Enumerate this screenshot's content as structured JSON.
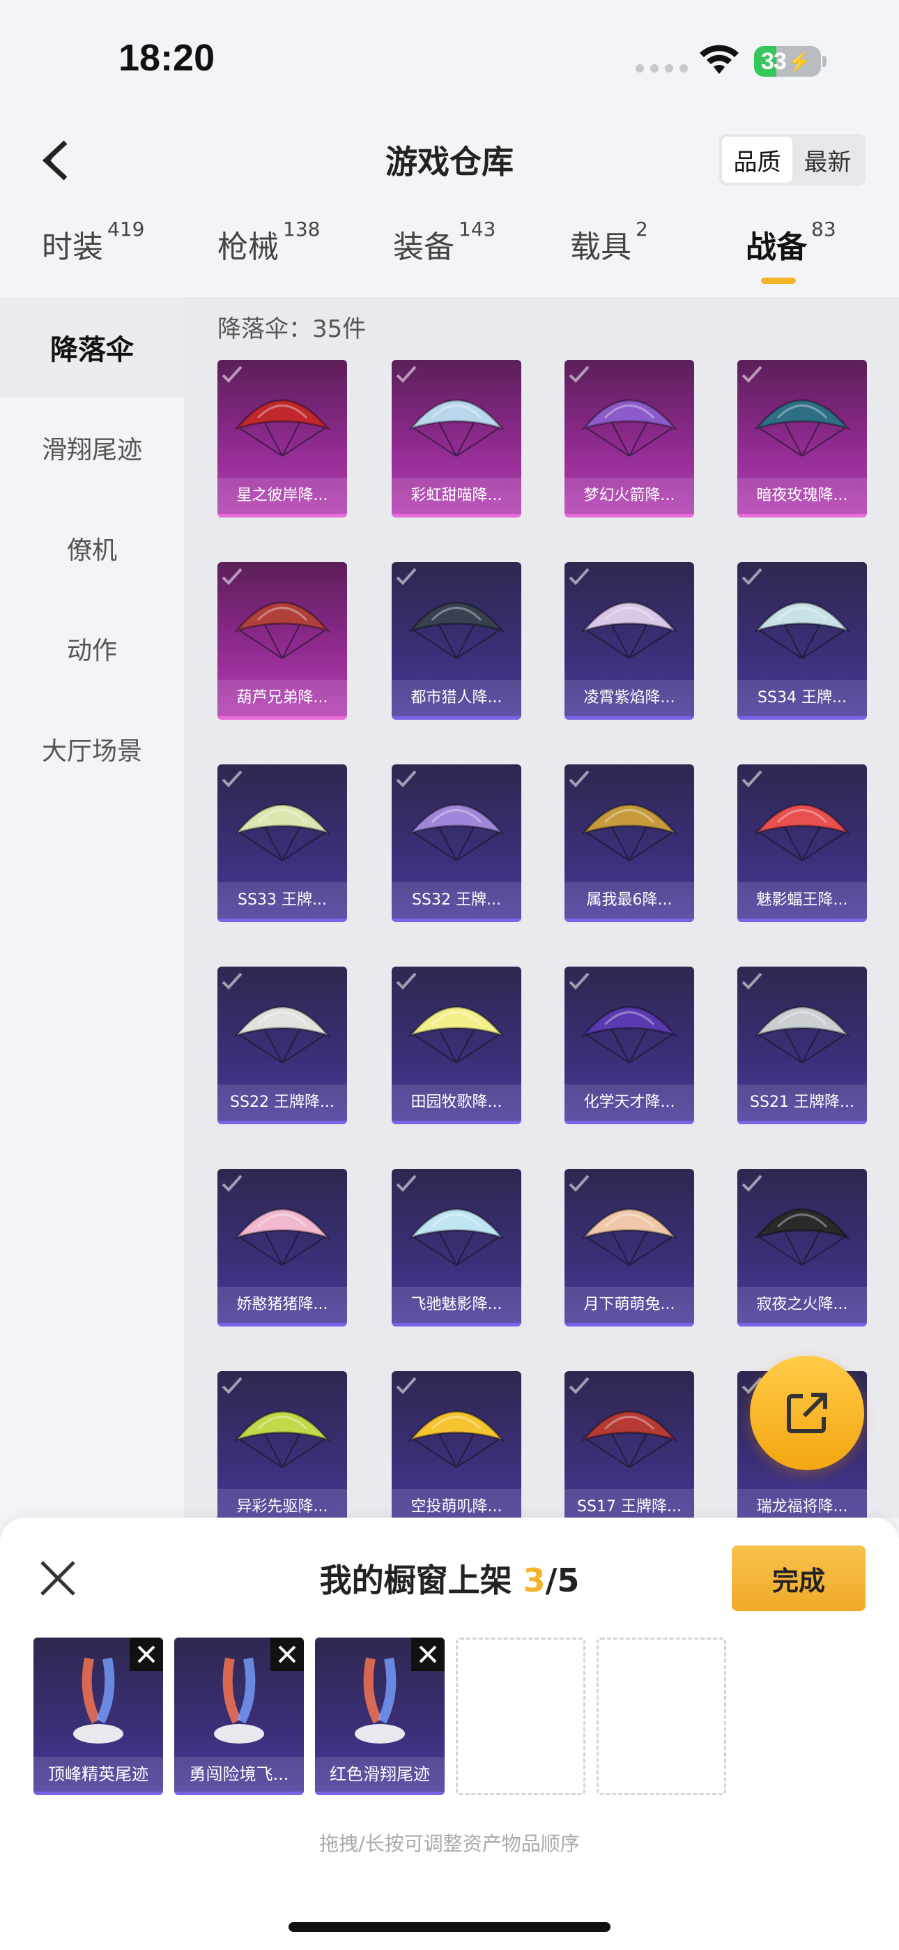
{
  "status_bar": {
    "time": "18:20",
    "battery": "33",
    "battery_level": 0.33
  },
  "header": {
    "title": "游戏仓库",
    "sort": [
      "品质",
      "最新"
    ],
    "sort_active": "品质"
  },
  "tabs": [
    {
      "label": "时装",
      "count": "419"
    },
    {
      "label": "枪械",
      "count": "138"
    },
    {
      "label": "装备",
      "count": "143"
    },
    {
      "label": "载具",
      "count": "2"
    },
    {
      "label": "战备",
      "count": "83"
    }
  ],
  "active_tab": "战备",
  "sidebar": {
    "items": [
      "降落伞",
      "滑翔尾迹",
      "僚机",
      "动作",
      "大厅场景"
    ],
    "active": "降落伞"
  },
  "main": {
    "count_label": "降落伞：35件"
  },
  "items": [
    {
      "name": "星之彼岸降...",
      "rarity": "legendary",
      "color": "#c0282b"
    },
    {
      "name": "彩虹甜喵降...",
      "rarity": "legendary",
      "color": "#b9d7ec"
    },
    {
      "name": "梦幻火箭降...",
      "rarity": "legendary",
      "color": "#8c5bc9"
    },
    {
      "name": "暗夜玫瑰降...",
      "rarity": "legendary",
      "color": "#2f6f86"
    },
    {
      "name": "葫芦兄弟降...",
      "rarity": "legendary",
      "color": "#b1403a"
    },
    {
      "name": "都市猎人降...",
      "rarity": "epic",
      "color": "#394150"
    },
    {
      "name": "凌霄紫焰降...",
      "rarity": "epic",
      "color": "#d8c7e6"
    },
    {
      "name": "SS34 王牌...",
      "rarity": "epic",
      "color": "#c9e1e6"
    },
    {
      "name": "SS33 王牌...",
      "rarity": "epic",
      "color": "#d8e8b0"
    },
    {
      "name": "SS32 王牌...",
      "rarity": "epic",
      "color": "#9e87d8"
    },
    {
      "name": "属我最6降...",
      "rarity": "epic",
      "color": "#c79a3c"
    },
    {
      "name": "魅影蝠王降...",
      "rarity": "epic",
      "color": "#e84f4f"
    },
    {
      "name": "SS22 王牌降...",
      "rarity": "epic",
      "color": "#e4e2dc"
    },
    {
      "name": "田园牧歌降...",
      "rarity": "epic",
      "color": "#f3f08a"
    },
    {
      "name": "化学天才降...",
      "rarity": "epic",
      "color": "#5a3ab0"
    },
    {
      "name": "SS21 王牌降...",
      "rarity": "epic",
      "color": "#c9cfd2"
    },
    {
      "name": "娇憨猪猪降...",
      "rarity": "epic",
      "color": "#f2b8cf"
    },
    {
      "name": "飞驰魅影降...",
      "rarity": "epic",
      "color": "#bfe4f2"
    },
    {
      "name": "月下萌萌兔...",
      "rarity": "epic",
      "color": "#f0c7a8"
    },
    {
      "name": "寂夜之火降...",
      "rarity": "epic",
      "color": "#2a2a2a"
    },
    {
      "name": "异彩先驱降...",
      "rarity": "epic",
      "color": "#c2d94b"
    },
    {
      "name": "空投萌叽降...",
      "rarity": "epic",
      "color": "#f5c531"
    },
    {
      "name": "SS17 王牌降...",
      "rarity": "epic",
      "color": "#b53b34"
    },
    {
      "name": "瑞龙福将降...",
      "rarity": "epic",
      "color": "#c49a3a"
    }
  ],
  "showcase": {
    "title": "我的橱窗上架",
    "current": "3",
    "separator": "/",
    "max": "5",
    "done_label": "完成",
    "slots": [
      {
        "name": "顶峰精英尾迹",
        "filled": true
      },
      {
        "name": "勇闯险境飞...",
        "filled": true
      },
      {
        "name": "红色滑翔尾迹",
        "filled": true
      },
      {
        "name": "",
        "filled": false
      },
      {
        "name": "",
        "filled": false
      }
    ],
    "hint": "拖拽/长按可调整资产物品顺序"
  }
}
